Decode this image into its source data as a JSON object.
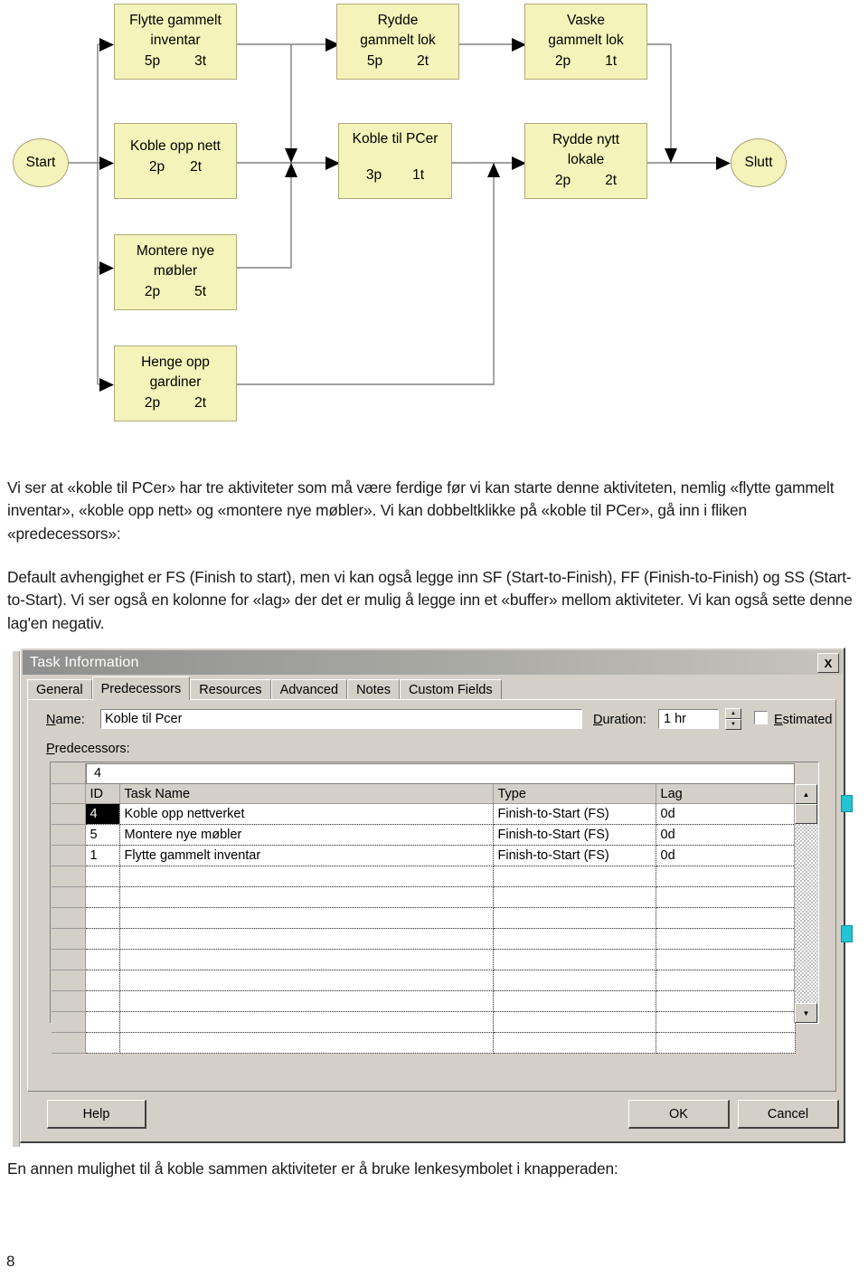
{
  "flowchart": {
    "start_label": "Start",
    "end_label": "Slutt",
    "nodes": [
      {
        "id": "flytte",
        "line1": "Flytte gammelt",
        "line2": "inventar",
        "people": "5p",
        "time": "3t"
      },
      {
        "id": "rydde_g",
        "line1": "Rydde",
        "line2": "gammelt lok",
        "people": "5p",
        "time": "2t"
      },
      {
        "id": "vaske",
        "line1": "Vaske",
        "line2": "gammelt lok",
        "people": "2p",
        "time": "1t"
      },
      {
        "id": "koblenett",
        "line1": "Koble opp nett",
        "line2": "",
        "people": "2p",
        "time": "2t"
      },
      {
        "id": "koblepc",
        "line1": "Koble til PCer",
        "line2": "",
        "people": "3p",
        "time": "1t"
      },
      {
        "id": "ryddenytt",
        "line1": "Rydde nytt",
        "line2": "lokale",
        "people": "2p",
        "time": "2t"
      },
      {
        "id": "montere",
        "line1": "Montere nye",
        "line2": "møbler",
        "people": "2p",
        "time": "5t"
      },
      {
        "id": "henge",
        "line1": "Henge opp",
        "line2": "gardiner",
        "people": "2p",
        "time": "2t"
      }
    ],
    "node_fill": "#f4f4ba",
    "node_border": "#b0a878",
    "connector_color": "#808080"
  },
  "body": {
    "paragraph1": "Vi ser at «koble til PCer» har tre aktiviteter som må være ferdige før vi kan starte denne aktiviteten, nemlig «flytte gammelt inventar», «koble opp nett» og «montere nye møbler».  Vi kan dobbeltklikke på «koble til PCer», gå inn i fliken «predecessors»:",
    "paragraph2": "Default avhengighet er FS (Finish to start), men vi kan også legge inn SF (Start-to-Finish), FF (Finish-to-Finish) og SS (Start-to-Start). Vi ser også en kolonne for «lag» der det er mulig å legge inn et «buffer» mellom aktiviteter. Vi kan også sette denne lag'en negativ.",
    "paragraph3": "En annen mulighet til å koble sammen aktiviteter er å bruke lenkesymbolet i knapperaden:",
    "page_number": "8"
  },
  "dialog": {
    "title": "Task Information",
    "close_label": "X",
    "tabs": [
      {
        "label": "General",
        "active": false
      },
      {
        "label": "Predecessors",
        "active": true
      },
      {
        "label": "Resources",
        "active": false
      },
      {
        "label": "Advanced",
        "active": false
      },
      {
        "label": "Notes",
        "active": false
      },
      {
        "label": "Custom Fields",
        "active": false
      }
    ],
    "name_label": "Name:",
    "name_value": "Koble til Pcer",
    "duration_label": "Duration:",
    "duration_value": "1 hr",
    "estimated_label": "Estimated",
    "estimated_checked": false,
    "predecessors_label": "Predecessors:",
    "edit_cell_value": "4",
    "grid": {
      "columns": [
        "ID",
        "Task Name",
        "Type",
        "Lag"
      ],
      "rows": [
        {
          "id": "4",
          "task_name": "Koble opp nettverket",
          "type": "Finish-to-Start (FS)",
          "lag": "0d",
          "selected": true
        },
        {
          "id": "5",
          "task_name": "Montere nye møbler",
          "type": "Finish-to-Start (FS)",
          "lag": "0d",
          "selected": false
        },
        {
          "id": "1",
          "task_name": "Flytte gammelt inventar",
          "type": "Finish-to-Start (FS)",
          "lag": "0d",
          "selected": false
        }
      ],
      "empty_row_count": 9
    },
    "scroll_up_glyph": "▲",
    "scroll_down_glyph": "▼",
    "spin_up_glyph": "▲",
    "spin_down_glyph": "▼",
    "buttons": {
      "help": "Help",
      "ok": "OK",
      "cancel": "Cancel"
    }
  }
}
